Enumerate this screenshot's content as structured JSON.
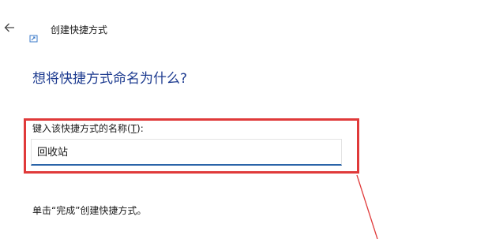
{
  "window": {
    "title": "创建快捷方式",
    "back_icon": "back-arrow-icon",
    "title_icon": "shortcut-icon"
  },
  "main": {
    "heading": "想将快捷方式命名为什么?",
    "name_label_prefix": "键入该快捷方式的名称(",
    "name_label_mnemonic": "T",
    "name_label_suffix": "):",
    "name_value": "回收站",
    "instruction": "单击“完成”创建快捷方式。"
  },
  "colors": {
    "heading": "#1c3a8f",
    "input_underline": "#2a64a8",
    "annotation": "#e03a3a"
  }
}
